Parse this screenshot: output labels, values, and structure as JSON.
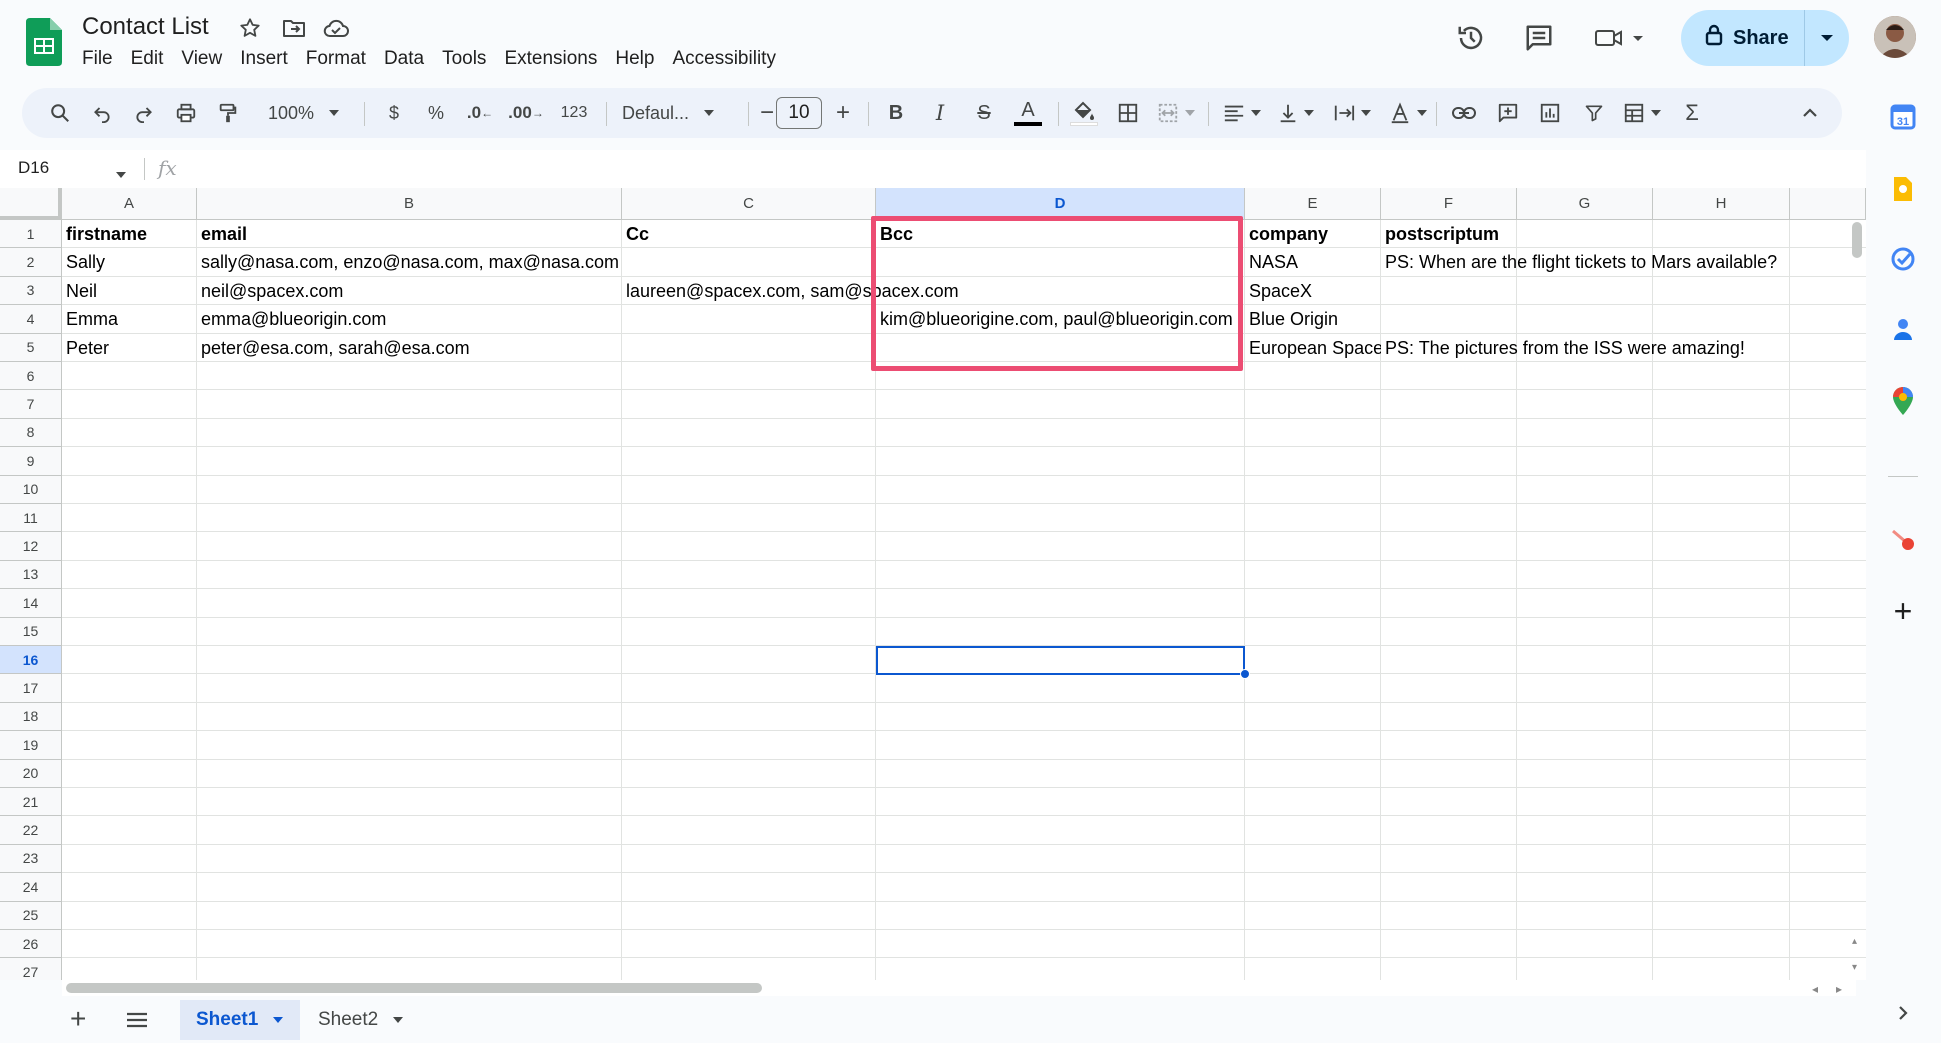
{
  "app": {
    "doc_title": "Contact List",
    "menu": [
      "File",
      "Edit",
      "View",
      "Insert",
      "Format",
      "Data",
      "Tools",
      "Extensions",
      "Help",
      "Accessibility"
    ],
    "share_label": "Share"
  },
  "toolbar": {
    "zoom": "100%",
    "currency": "$",
    "percent": "%",
    "dec_decrease": ".0",
    "dec_increase": ".00",
    "number_format": "123",
    "font": "Defaul...",
    "font_size": "10",
    "minus": "−",
    "plus": "+",
    "bold": "B",
    "italic": "I",
    "strike": "S",
    "text_color": "A",
    "sum": "Σ"
  },
  "formula_bar": {
    "name_box": "D16",
    "fx": "fx",
    "value": ""
  },
  "grid": {
    "columns": [
      "A",
      "B",
      "C",
      "D",
      "E",
      "F",
      "G",
      "H"
    ],
    "selected_column": "D",
    "selected_row": "16",
    "rows": [
      "1",
      "2",
      "3",
      "4",
      "5",
      "6",
      "7",
      "8",
      "9",
      "10",
      "11",
      "12",
      "13",
      "14",
      "15",
      "16",
      "17",
      "18",
      "19",
      "20",
      "21",
      "22",
      "23",
      "24",
      "25",
      "26",
      "27"
    ],
    "headers": {
      "A": "firstname",
      "B": "email",
      "C": "Cc",
      "D": "Bcc",
      "E": "company",
      "F": "postscriptum"
    },
    "data": [
      {
        "A": "Sally",
        "B": "sally@nasa.com, enzo@nasa.com, max@nasa.com",
        "C": "",
        "D": "",
        "E": "NASA",
        "F": "PS: When are the flight tickets to Mars available?"
      },
      {
        "A": "Neil",
        "B": "neil@spacex.com",
        "C": "laureen@spacex.com, sam@spacex.com",
        "D": "",
        "E": "SpaceX",
        "F": ""
      },
      {
        "A": "Emma",
        "B": "emma@blueorigin.com",
        "C": "",
        "D": "kim@blueorigine.com, paul@blueorigin.com",
        "E": "Blue Origin",
        "F": ""
      },
      {
        "A": "Peter",
        "B": "peter@esa.com, sarah@esa.com",
        "C": "",
        "D": "",
        "E": "European Space",
        "F": "PS: The pictures from the ISS were amazing!"
      }
    ]
  },
  "sheets": [
    {
      "name": "Sheet1",
      "active": true
    },
    {
      "name": "Sheet2",
      "active": false
    }
  ],
  "colors": {
    "accent": "#0b57d0",
    "share_bg": "#c2e7ff",
    "highlight_box": "#ec4d73",
    "sheets_green": "#0f9d58"
  }
}
